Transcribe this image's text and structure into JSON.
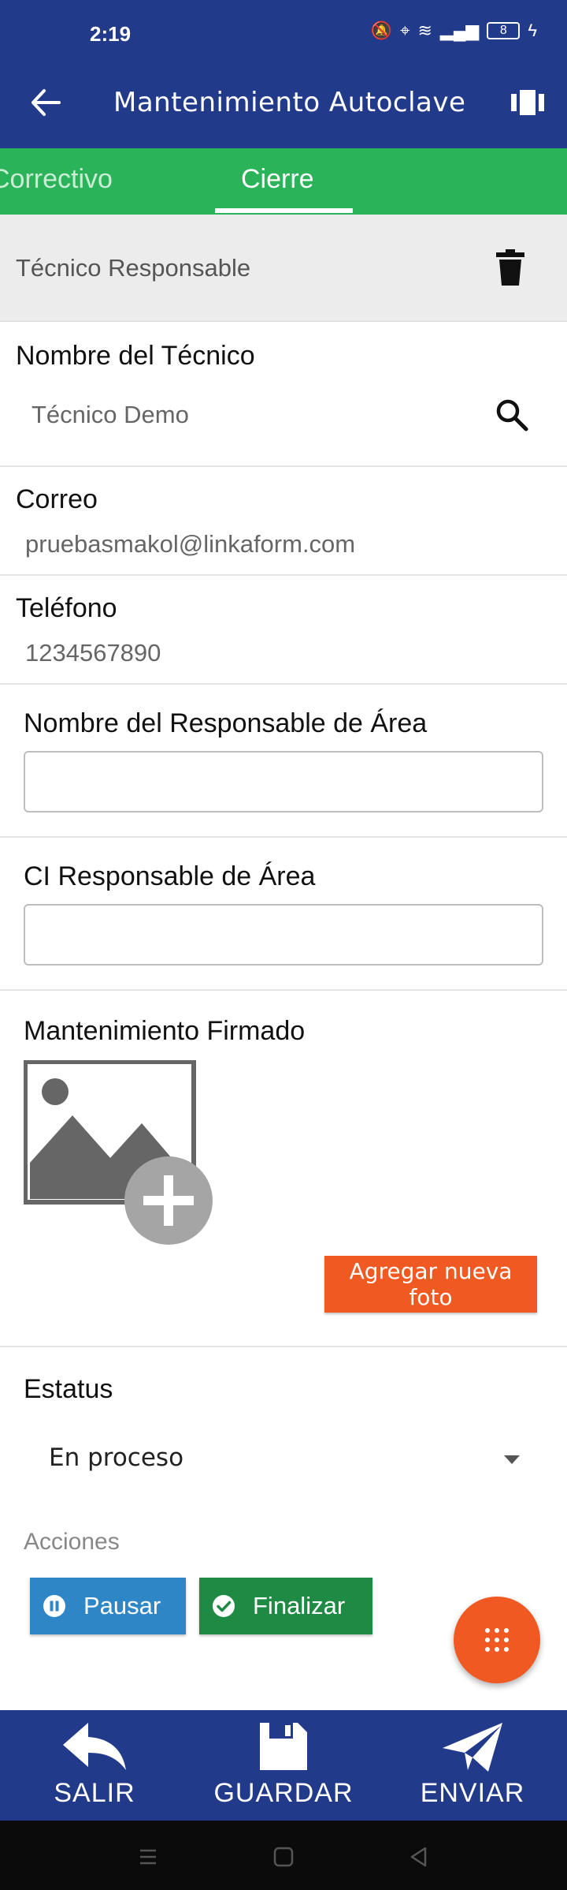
{
  "status_bar": {
    "time": "2:19",
    "battery": "8"
  },
  "app_bar": {
    "title": "Mantenimiento Autoclave"
  },
  "tabs": [
    {
      "label": "Correctivo",
      "active": false
    },
    {
      "label": "Cierre",
      "active": true
    }
  ],
  "section": {
    "title": "Técnico Responsable"
  },
  "fields": {
    "technician_name": {
      "label": "Nombre del Técnico",
      "value": "Técnico Demo"
    },
    "email": {
      "label": "Correo",
      "value": "pruebasmakol@linkaform.com"
    },
    "phone": {
      "label": "Teléfono",
      "value": "1234567890"
    },
    "area_manager_name": {
      "label": "Nombre del Responsable de Área",
      "value": ""
    },
    "area_manager_ci": {
      "label": "CI Responsable de Área",
      "value": ""
    },
    "signed_maintenance": {
      "label": "Mantenimiento Firmado",
      "add_photo_label": "Agregar nueva foto"
    },
    "status": {
      "label": "Estatus",
      "value": "En proceso"
    }
  },
  "actions": {
    "label": "Acciones",
    "pause_label": "Pausar",
    "finish_label": "Finalizar"
  },
  "bottom_bar": {
    "exit_label": "SALIR",
    "save_label": "GUARDAR",
    "send_label": "ENVIAR"
  },
  "colors": {
    "primary": "#223a8a",
    "tab_green": "#2bb35a",
    "accent_orange": "#f05a22",
    "pause_blue": "#2f86c6",
    "finish_green": "#1e8a43"
  }
}
